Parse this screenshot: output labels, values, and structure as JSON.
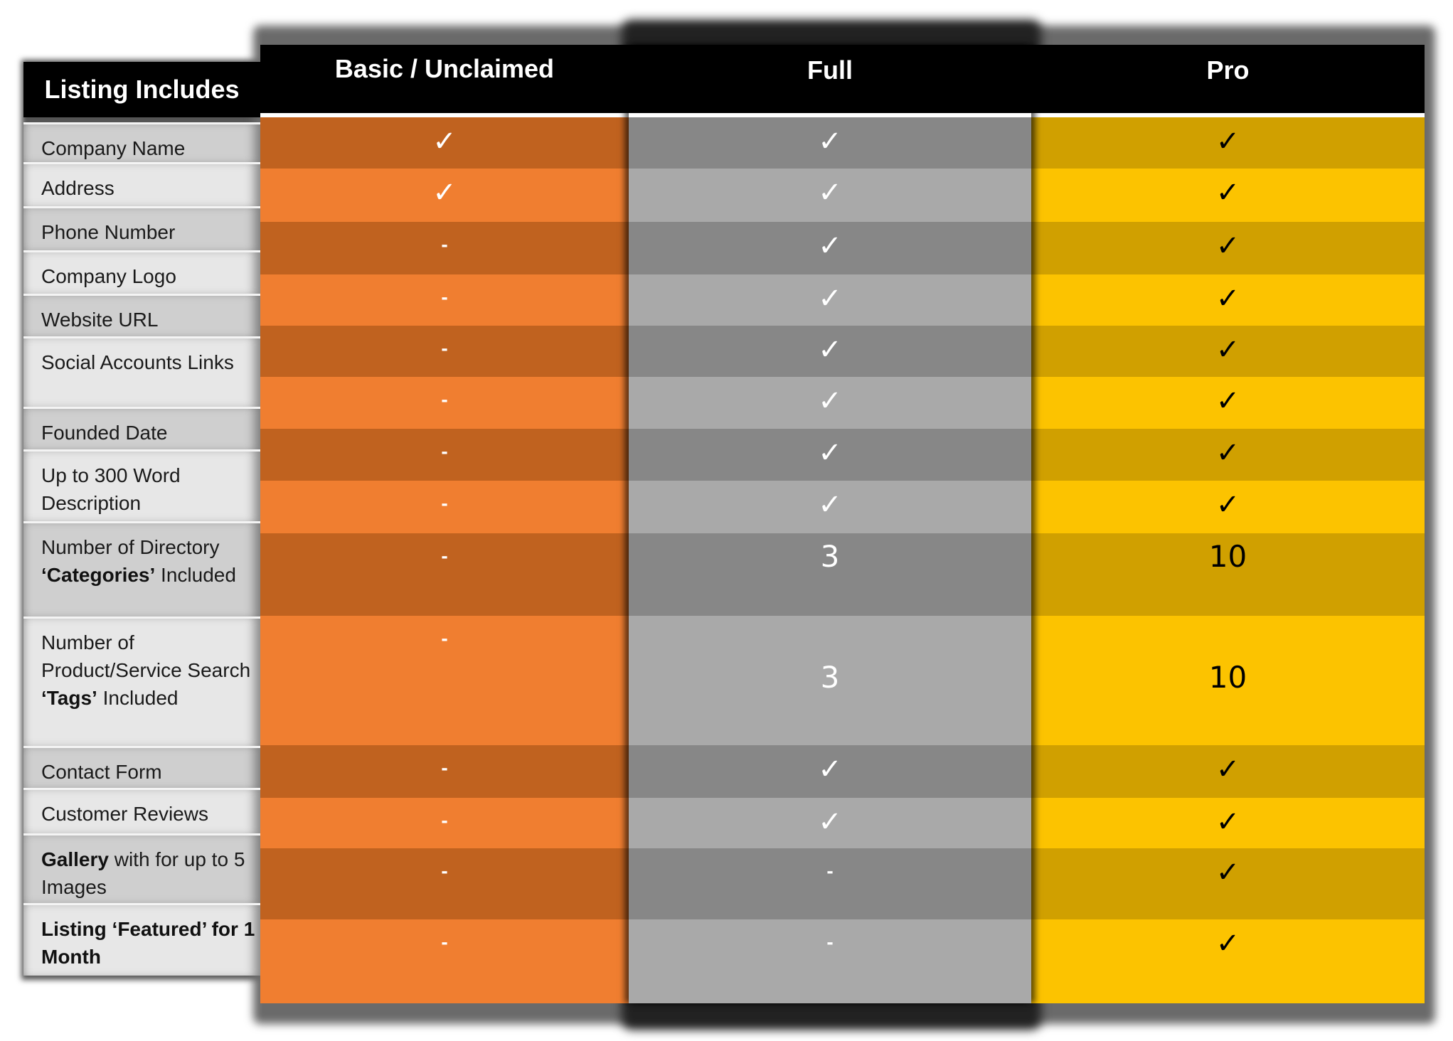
{
  "table": {
    "label_header": "Listing Includes",
    "columns": [
      {
        "key": "basic",
        "label": "Basic / Unclaimed",
        "color_dark": "#c0621f",
        "color_light": "#f07e30",
        "mark_color": "#ffffff"
      },
      {
        "key": "full",
        "label": "Full",
        "color_dark": "#878787",
        "color_light": "#a9a9a9",
        "mark_color": "#ffffff"
      },
      {
        "key": "pro",
        "label": "Pro",
        "color_dark": "#d0a000",
        "color_light": "#fcc300",
        "mark_color": "#000000"
      }
    ],
    "labels": [
      {
        "parts": [
          {
            "text": "Company Name",
            "bold": false
          }
        ]
      },
      {
        "parts": [
          {
            "text": "Address",
            "bold": false
          }
        ]
      },
      {
        "parts": [
          {
            "text": "Phone Number",
            "bold": false
          }
        ]
      },
      {
        "parts": [
          {
            "text": "Company Logo",
            "bold": false
          }
        ]
      },
      {
        "parts": [
          {
            "text": "Website URL",
            "bold": false
          }
        ]
      },
      {
        "parts": [
          {
            "text": "Social Accounts Links",
            "bold": false
          }
        ]
      },
      {
        "parts": [
          {
            "text": "Founded Date",
            "bold": false
          }
        ]
      },
      {
        "parts": [
          {
            "text": "Up to 300 Word Description",
            "bold": false
          }
        ]
      },
      {
        "parts": [
          {
            "text": "Number of Directory ",
            "bold": false
          },
          {
            "text": "‘Categories’",
            "bold": true
          },
          {
            "text": " Included",
            "bold": false
          }
        ]
      },
      {
        "parts": [
          {
            "text": "Number of Product/Service Search ",
            "bold": false
          },
          {
            "text": "‘Tags’",
            "bold": true
          },
          {
            "text": " Included",
            "bold": false
          }
        ]
      },
      {
        "parts": [
          {
            "text": "Contact Form",
            "bold": false
          }
        ]
      },
      {
        "parts": [
          {
            "text": "Customer Reviews",
            "bold": false
          }
        ]
      },
      {
        "parts": [
          {
            "text": "Gallery",
            "bold": true
          },
          {
            "text": " with for up to 5 Images",
            "bold": false
          }
        ]
      },
      {
        "parts": [
          {
            "text": "Listing ‘Featured’ for 1 Month",
            "bold": true
          }
        ]
      }
    ],
    "rows": [
      {
        "basic": "check",
        "full": "check",
        "pro": "check"
      },
      {
        "basic": "check",
        "full": "check",
        "pro": "check"
      },
      {
        "basic": "dash",
        "full": "check",
        "pro": "check"
      },
      {
        "basic": "dash",
        "full": "check",
        "pro": "check"
      },
      {
        "basic": "dash",
        "full": "check",
        "pro": "check"
      },
      {
        "basic": "dash",
        "full": "check",
        "pro": "check"
      },
      {
        "basic": "dash",
        "full": "check",
        "pro": "check"
      },
      {
        "basic": "dash",
        "full": "check",
        "pro": "check"
      },
      {
        "basic": "dash",
        "full": "3",
        "pro": "10"
      },
      {
        "basic": "dash",
        "full": "3",
        "pro": "10"
      },
      {
        "basic": "dash",
        "full": "check",
        "pro": "check"
      },
      {
        "basic": "dash",
        "full": "check",
        "pro": "check"
      },
      {
        "basic": "dash",
        "full": "dash",
        "pro": "check"
      },
      {
        "basic": "dash",
        "full": "dash",
        "pro": "check"
      }
    ],
    "glyphs": {
      "check": "✓",
      "dash": "-"
    }
  }
}
